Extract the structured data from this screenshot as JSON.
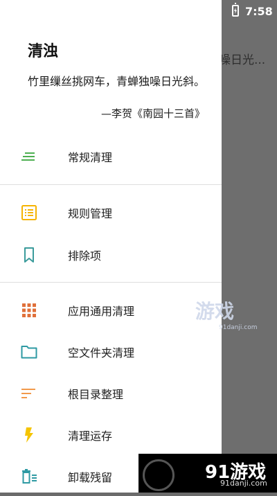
{
  "status_bar": {
    "time": "7:58"
  },
  "background_screen": {
    "toolbar_text": "噪日光..."
  },
  "drawer": {
    "title": "清浊",
    "quote": "竹里缫丝挑网车，青蝉独噪日光斜。",
    "author": "—李贺《南园十三首》",
    "items": [
      {
        "label": "常规清理",
        "icon": "lines-icon",
        "color": "#4caf50"
      },
      {
        "label": "规则管理",
        "icon": "list-icon",
        "color": "#f5b301"
      },
      {
        "label": "排除项",
        "icon": "bookmark-icon",
        "color": "#3a9b9b"
      },
      {
        "label": "应用通用清理",
        "icon": "grid-icon",
        "color": "#e0703a"
      },
      {
        "label": "空文件夹清理",
        "icon": "folder-icon",
        "color": "#2e9aa3"
      },
      {
        "label": "根目录整理",
        "icon": "sort-icon",
        "color": "#f2994a"
      },
      {
        "label": "清理运存",
        "icon": "flash-icon",
        "color": "#f5c400"
      },
      {
        "label": "卸载残留",
        "icon": "trash-list-icon",
        "color": "#2e9aa3"
      }
    ]
  },
  "watermark": {
    "logo_text": "91游戏",
    "site": "91danji.com",
    "small_logo": "游戏",
    "small_site": "91danji.com"
  }
}
